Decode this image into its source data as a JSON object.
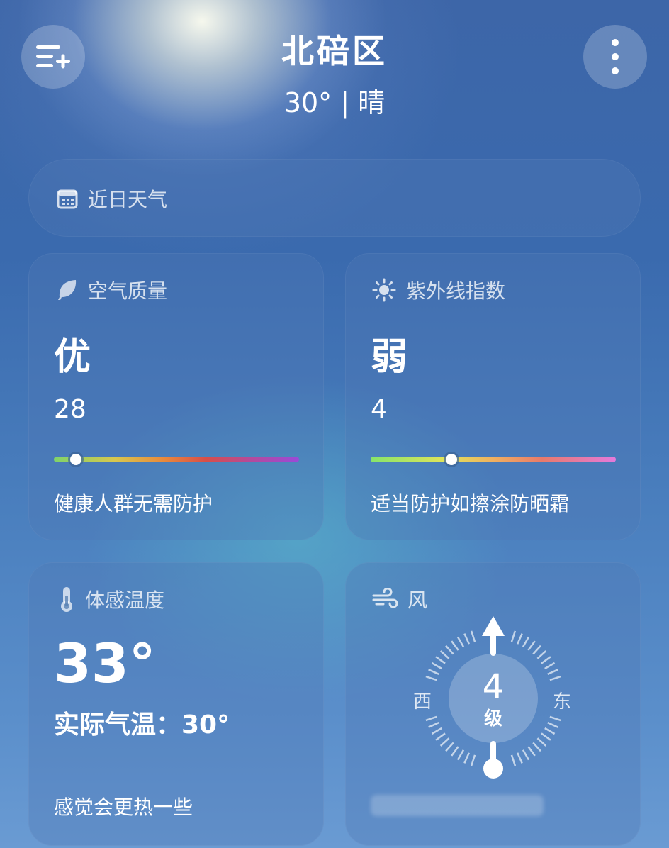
{
  "header": {
    "city": "北碚区",
    "condition": "30° | 晴",
    "menu_icon": "list-add-icon",
    "more_icon": "more-vertical-icon"
  },
  "forecast": {
    "icon": "calendar-icon",
    "label": "近日天气"
  },
  "air_quality": {
    "icon": "leaf-icon",
    "title": "空气质量",
    "level": "优",
    "value": "28",
    "position": 0.09,
    "advice": "健康人群无需防护"
  },
  "uv": {
    "icon": "sun-icon",
    "title": "紫外线指数",
    "level": "弱",
    "value": "4",
    "position": 0.33,
    "advice": "适当防护如擦涂防晒霜"
  },
  "feels_like": {
    "icon": "thermometer-icon",
    "title": "体感温度",
    "value": "33°",
    "actual": "实际气温：30°",
    "advice": "感觉会更热一些"
  },
  "wind": {
    "icon": "wind-icon",
    "title": "风",
    "level_num": "4",
    "level_unit": "级",
    "west": "西",
    "east": "东"
  }
}
